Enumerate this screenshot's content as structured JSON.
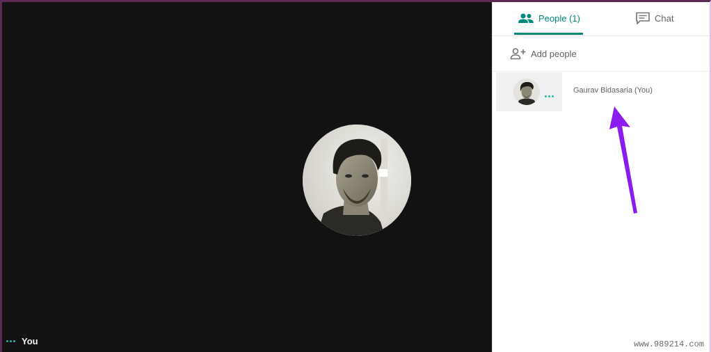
{
  "stage": {
    "self_label": "You"
  },
  "panel": {
    "tabs": [
      {
        "label": "People (1)",
        "icon": "people-icon",
        "active": true
      },
      {
        "label": "Chat",
        "icon": "chat-icon",
        "active": false
      }
    ],
    "add_people_label": "Add people",
    "participants": [
      {
        "name": "Gaurav Bidasaria (You)"
      }
    ]
  },
  "colors": {
    "accent": "#00897b",
    "stage_background": "#121212",
    "speaking_dots": "#27b5a6",
    "annotation_arrow": "#8a1cf0"
  },
  "watermark": "www.989214.com"
}
